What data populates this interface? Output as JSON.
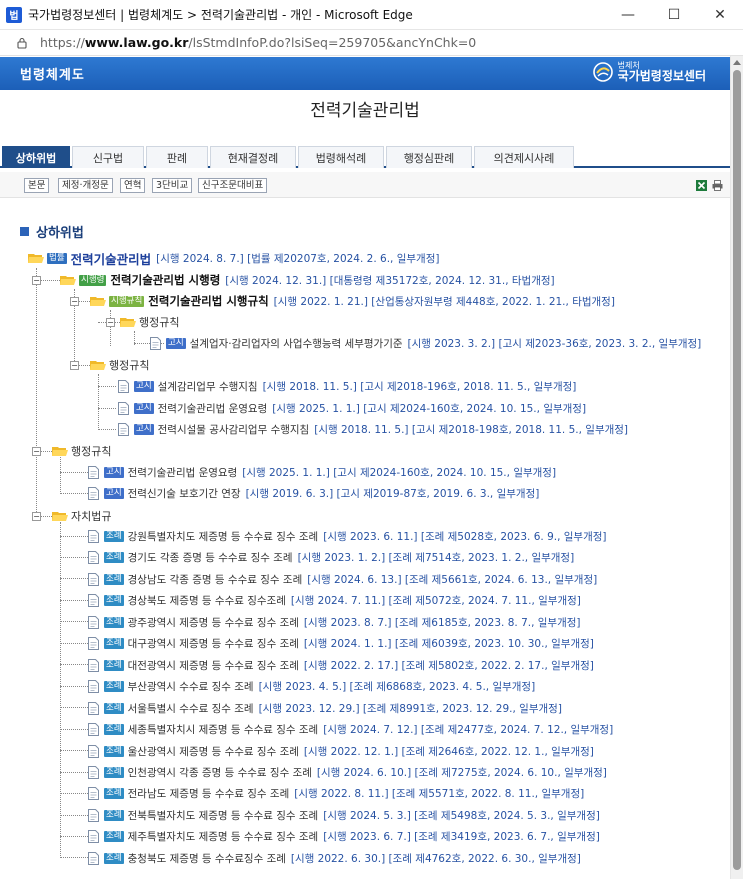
{
  "window": {
    "title": "국가법령정보센터 | 법령체계도 > 전력기술관리법 - 개인 - Microsoft Edge",
    "app_icon_label": "법",
    "minimize": "—",
    "maximize": "☐",
    "close": "✕"
  },
  "address": {
    "url_prefix": "https://",
    "url_domain": "www.law.go.kr",
    "url_path": "/lsStmdInfoP.do?lsiSeq=259705&ancYnChk=0"
  },
  "banner": {
    "title": "법령체계도",
    "logo_sub": "법제처",
    "logo_main": "국가법령정보센터"
  },
  "law_title": "전력기술관리법",
  "tabs": [
    "상하위법",
    "신구법",
    "판례",
    "현재결정례",
    "법령해석례",
    "행정심판례",
    "의견제시사례"
  ],
  "sub_buttons": [
    "본문",
    "제정·개정문",
    "연혁",
    "3단비교",
    "신구조문대비표"
  ],
  "section_title": "상하위법",
  "badges": {
    "law": "법률",
    "decree": "시행령",
    "rule": "시행규칙",
    "notice": "고시",
    "ordinance": "조례"
  },
  "tree": {
    "root": {
      "title": "전력기술관리법",
      "info": "[시행 2024. 8. 7.] [법률 제20207호, 2024. 2. 6., 일부개정]"
    },
    "decree": {
      "title": "전력기술관리법 시행령",
      "info": "[시행 2024. 12. 31.] [대통령령 제35172호, 2024. 12. 31., 타법개정]"
    },
    "rule": {
      "title": "전력기술관리법 시행규칙",
      "info": "[시행 2022. 1. 21.] [산업통상자원부령 제448호, 2022. 1. 21., 타법개정]"
    },
    "rule_admin_folder": "행정규칙",
    "rule_admin_items": [
      {
        "title": "설계업자·감리업자의 사업수행능력 세부평가기준",
        "info": "[시행 2023. 3. 2.] [고시 제2023-36호, 2023. 3. 2., 일부개정]"
      }
    ],
    "decree_admin_folder": "행정규칙",
    "decree_admin_items": [
      {
        "title": "설계감리업무 수행지침",
        "info": "[시행 2018. 11. 5.] [고시 제2018-196호, 2018. 11. 5., 일부개정]"
      },
      {
        "title": "전력기술관리법 운영요령",
        "info": "[시행 2025. 1. 1.] [고시 제2024-160호, 2024. 10. 15., 일부개정]"
      },
      {
        "title": "전력시설물 공사감리업무 수행지침",
        "info": "[시행 2018. 11. 5.] [고시 제2018-198호, 2018. 11. 5., 일부개정]"
      }
    ],
    "law_admin_folder": "행정규칙",
    "law_admin_items": [
      {
        "title": "전력기술관리법 운영요령",
        "info": "[시행 2025. 1. 1.] [고시 제2024-160호, 2024. 10. 15., 일부개정]"
      },
      {
        "title": "전력신기술 보호기간 연장",
        "info": "[시행 2019. 6. 3.] [고시 제2019-87호, 2019. 6. 3., 일부개정]"
      }
    ],
    "local_folder": "자치법규",
    "local_items": [
      {
        "title": "강원특별자치도 제증명 등 수수료 징수 조례",
        "info": "[시행 2023. 6. 11.] [조례 제5028호, 2023. 6. 9., 일부개정]"
      },
      {
        "title": "경기도 각종 증명 등 수수료 징수 조례",
        "info": "[시행 2023. 1. 2.] [조례 제7514호, 2023. 1. 2., 일부개정]"
      },
      {
        "title": "경상남도 각종 증명 등 수수료 징수 조례",
        "info": "[시행 2024. 6. 13.] [조례 제5661호, 2024. 6. 13., 일부개정]"
      },
      {
        "title": "경상북도 제증명 등 수수료 징수조례",
        "info": "[시행 2024. 7. 11.] [조례 제5072호, 2024. 7. 11., 일부개정]"
      },
      {
        "title": "광주광역시 제증명 등 수수료 징수 조례",
        "info": "[시행 2023. 8. 7.] [조례 제6185호, 2023. 8. 7., 일부개정]"
      },
      {
        "title": "대구광역시 제증명 등 수수료 징수 조례",
        "info": "[시행 2024. 1. 1.] [조례 제6039호, 2023. 10. 30., 일부개정]"
      },
      {
        "title": "대전광역시 제증명 등 수수료 징수 조례",
        "info": "[시행 2022. 2. 17.] [조례 제5802호, 2022. 2. 17., 일부개정]"
      },
      {
        "title": "부산광역시 수수료 징수 조례",
        "info": "[시행 2023. 4. 5.] [조례 제6868호, 2023. 4. 5., 일부개정]"
      },
      {
        "title": "서울특별시 수수료 징수 조례",
        "info": "[시행 2023. 12. 29.] [조례 제8991호, 2023. 12. 29., 일부개정]"
      },
      {
        "title": "세종특별자치시 제증명 등 수수료 징수 조례",
        "info": "[시행 2024. 7. 12.] [조례 제2477호, 2024. 7. 12., 일부개정]"
      },
      {
        "title": "울산광역시 제증명 등 수수료 징수 조례",
        "info": "[시행 2022. 12. 1.] [조례 제2646호, 2022. 12. 1., 일부개정]"
      },
      {
        "title": "인천광역시 각종 증명 등 수수료 징수 조례",
        "info": "[시행 2024. 6. 10.] [조례 제7275호, 2024. 6. 10., 일부개정]"
      },
      {
        "title": "전라남도 제증명 등 수수료 징수 조례",
        "info": "[시행 2022. 8. 11.] [조례 제5571호, 2022. 8. 11., 일부개정]"
      },
      {
        "title": "전북특별자치도 제증명 등 수수료 징수 조례",
        "info": "[시행 2024. 5. 3.] [조례 제5498호, 2024. 5. 3., 일부개정]"
      },
      {
        "title": "제주특별자치도 제증명 등 수수료 징수 조례",
        "info": "[시행 2023. 6. 7.] [조례 제3419호, 2023. 6. 7., 일부개정]"
      },
      {
        "title": "충청북도 제증명 등 수수료징수 조례",
        "info": "[시행 2022. 6. 30.] [조례 제4762호, 2022. 6. 30., 일부개정]"
      }
    ]
  },
  "colors": {
    "banner": "#1c5fb8",
    "tab_active": "#1f4e8a",
    "link": "#2752a3",
    "root_title": "#1c3f9b",
    "badge_law": "#2e6fbf",
    "badge_decree": "#43a047",
    "badge_rule": "#7cb342",
    "badge_notice": "#3f6fc9",
    "badge_ordinance": "#2f8cc4",
    "folder": "#f0b92a"
  }
}
